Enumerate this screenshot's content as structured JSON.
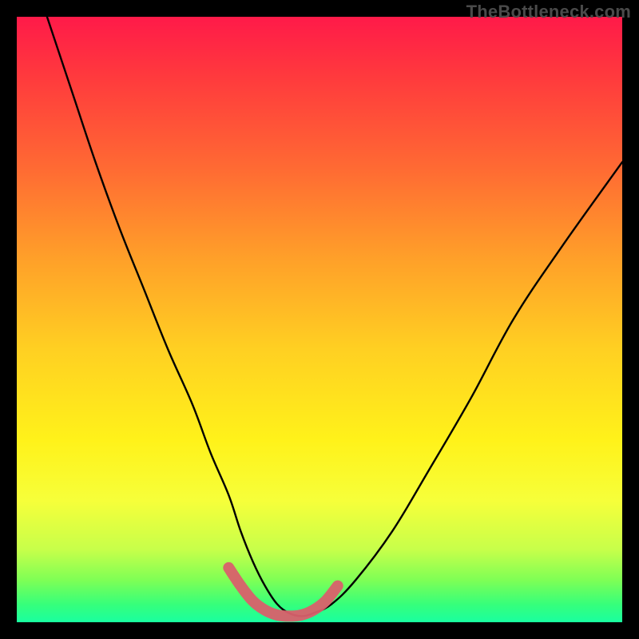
{
  "watermark": "TheBottleneck.com",
  "chart_data": {
    "type": "line",
    "title": "",
    "xlabel": "",
    "ylabel": "",
    "xlim": [
      0,
      100
    ],
    "ylim": [
      0,
      100
    ],
    "series": [
      {
        "name": "bottleneck-curve",
        "x": [
          5,
          9,
          13,
          17,
          21,
          25,
          29,
          32,
          35,
          37,
          39,
          41,
          43,
          45,
          47,
          49,
          52,
          56,
          62,
          68,
          75,
          82,
          90,
          100
        ],
        "y": [
          100,
          88,
          76,
          65,
          55,
          45,
          36,
          28,
          21,
          15,
          10,
          6,
          3,
          1.5,
          1,
          1.5,
          3,
          7,
          15,
          25,
          37,
          50,
          62,
          76
        ]
      }
    ],
    "highlight": {
      "name": "low-bottleneck-band",
      "x": [
        35,
        37,
        39,
        41,
        43,
        45,
        47,
        49,
        51,
        53
      ],
      "y": [
        9,
        6,
        3.5,
        2,
        1.2,
        1,
        1.2,
        2,
        3.5,
        6
      ]
    },
    "background_gradient": {
      "stops": [
        {
          "pos": 0.0,
          "color": "#ff1a49"
        },
        {
          "pos": 0.25,
          "color": "#ff6a33"
        },
        {
          "pos": 0.55,
          "color": "#ffd022"
        },
        {
          "pos": 0.8,
          "color": "#f6ff3a"
        },
        {
          "pos": 0.95,
          "color": "#37ff7a"
        },
        {
          "pos": 1.0,
          "color": "#19ffa0"
        }
      ]
    }
  }
}
